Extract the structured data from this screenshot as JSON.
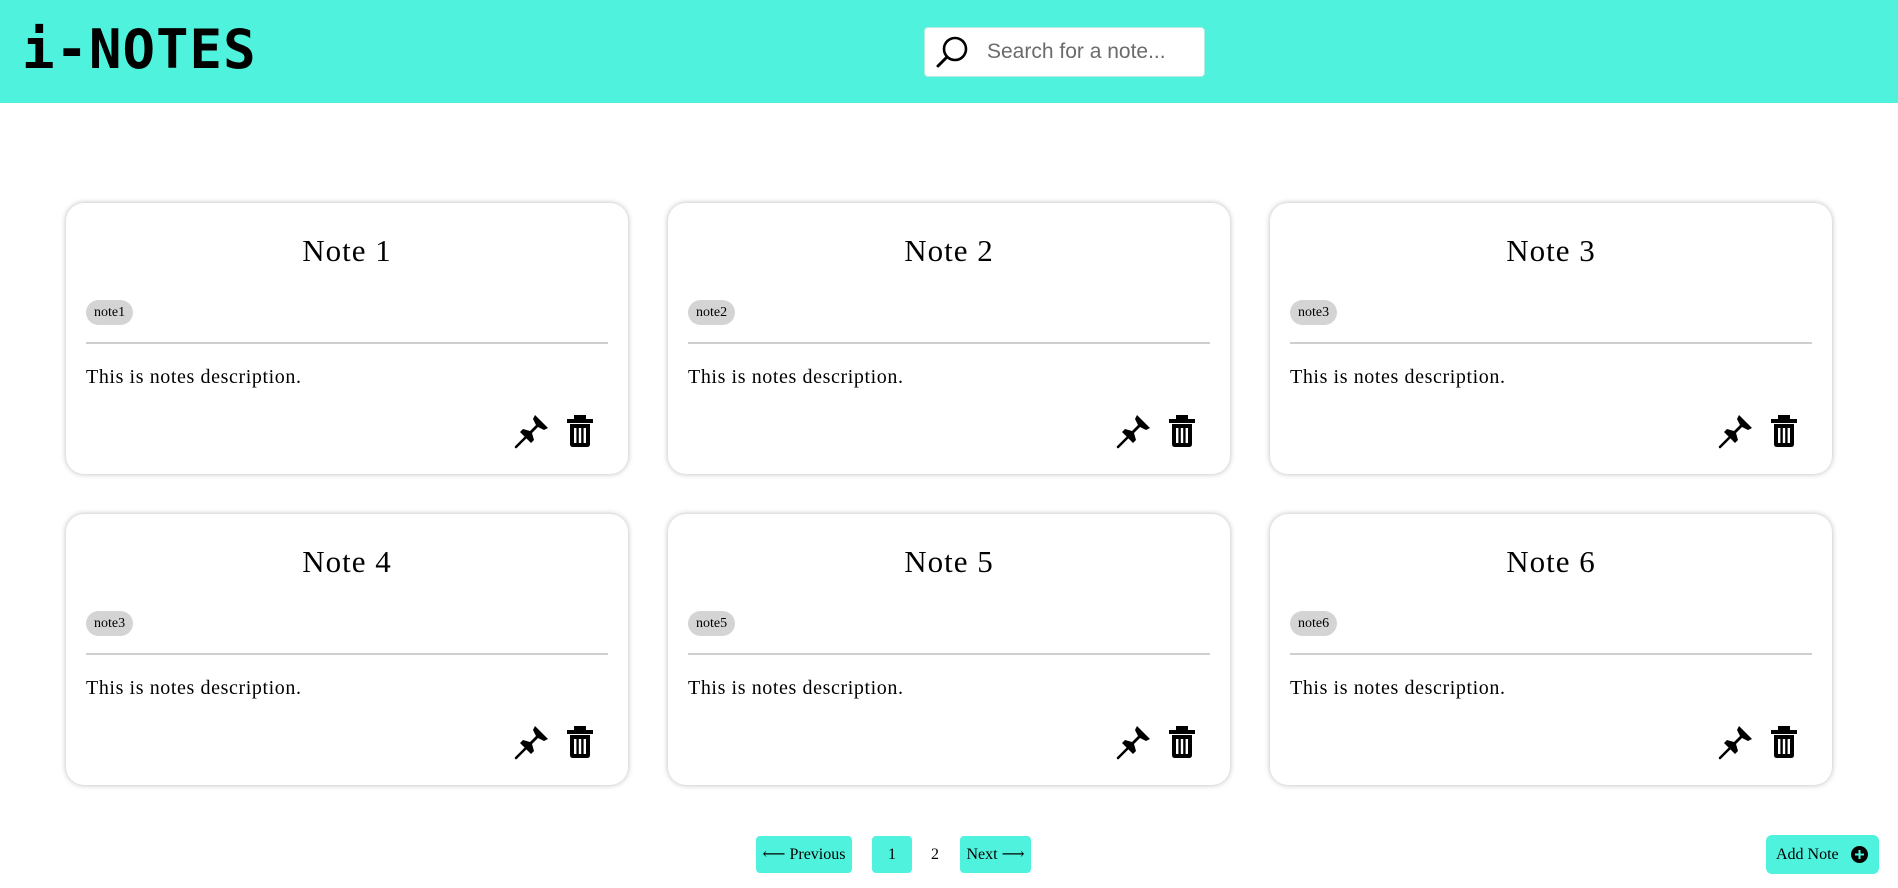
{
  "app": {
    "logo_text": "i-NOTES"
  },
  "search": {
    "placeholder": "Search for a note..."
  },
  "notes": [
    {
      "title": "Note 1",
      "tag": "note1",
      "description": "This is notes description."
    },
    {
      "title": "Note 2",
      "tag": "note2",
      "description": "This is notes description."
    },
    {
      "title": "Note 3",
      "tag": "note3",
      "description": "This is notes description."
    },
    {
      "title": "Note 4",
      "tag": "note3",
      "description": "This is notes description."
    },
    {
      "title": "Note 5",
      "tag": "note5",
      "description": "This is notes description."
    },
    {
      "title": "Note 6",
      "tag": "note6",
      "description": "This is notes description."
    }
  ],
  "card_icons": {
    "pin": "pushpin-icon",
    "delete": "trash-icon"
  },
  "pagination": {
    "previous_label": "⟵ Previous",
    "pages": [
      "1",
      "2"
    ],
    "current_page": "1",
    "next_label": "Next ⟶"
  },
  "add_note": {
    "label": "Add Note",
    "icon": "plus-circle-icon"
  },
  "colors": {
    "accent": "#4ff2dc",
    "tag_bg": "#d4d4d4",
    "text": "#000000"
  }
}
